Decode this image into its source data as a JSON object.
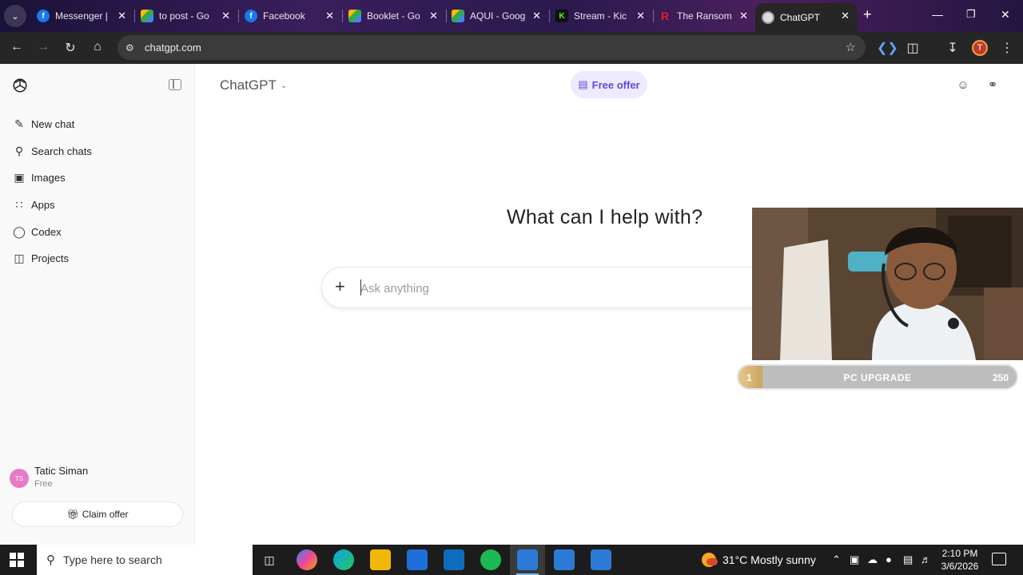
{
  "browser": {
    "tabs": [
      {
        "label": "Messenger |",
        "favicon": "facebook-icon",
        "color": "#1877f2"
      },
      {
        "label": "to post - Go",
        "favicon": "google-drive-icon",
        "color": "#34a853"
      },
      {
        "label": "Facebook",
        "favicon": "facebook-icon",
        "color": "#1877f2"
      },
      {
        "label": "Booklet - Go",
        "favicon": "google-drive-icon",
        "color": "#34a853"
      },
      {
        "label": "AQUI - Goog",
        "favicon": "google-drive-icon",
        "color": "#34a853"
      },
      {
        "label": "Stream - Kic",
        "favicon": "kick-icon",
        "color": "#53fc18"
      },
      {
        "label": "The Ransom",
        "favicon": "r-icon",
        "color": "#e02020"
      },
      {
        "label": "ChatGPT",
        "favicon": "chatgpt-icon",
        "color": "#ffffff"
      }
    ],
    "new_tab_label": "+",
    "url": "chatgpt.com",
    "profile_initial": "T"
  },
  "sidebar": {
    "items": [
      {
        "label": "New chat",
        "icon": "pencil-square-icon"
      },
      {
        "label": "Search chats",
        "icon": "search-icon"
      },
      {
        "label": "Images",
        "icon": "images-icon"
      },
      {
        "label": "Apps",
        "icon": "apps-grid-icon"
      },
      {
        "label": "Codex",
        "icon": "codex-icon"
      },
      {
        "label": "Projects",
        "icon": "folder-icon"
      }
    ],
    "user": {
      "initials": "TS",
      "name": "Tatic Siman",
      "plan": "Free"
    },
    "claim_offer": "Claim offer"
  },
  "main": {
    "model": "ChatGPT",
    "free_offer": "Free offer",
    "headline": "What can I help with?",
    "composer_placeholder": "Ask anything"
  },
  "overlay": {
    "progress_start": "1",
    "progress_label": "PC UPGRADE",
    "progress_goal": "250",
    "progress_fraction": 0.004
  },
  "taskbar": {
    "search_placeholder": "Type here to search",
    "weather_temp": "31°C",
    "weather_desc": "Mostly sunny",
    "time": "2:10 PM",
    "date": "3/6/2026"
  },
  "colors": {
    "accent": "#5b4bdb",
    "free_offer_bg": "#eeeaff",
    "sidebar_bg": "#f9f9f9",
    "tab_active_bg": "#262626"
  }
}
